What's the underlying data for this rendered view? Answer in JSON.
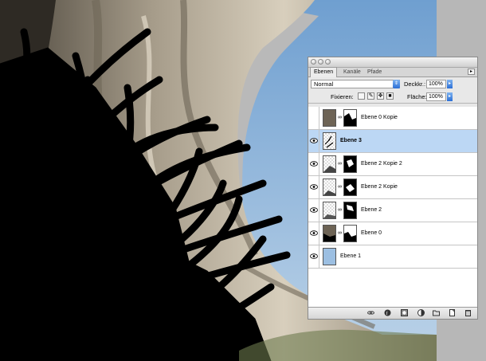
{
  "palette": {
    "tabs": [
      "Ebenen",
      "Kanäle",
      "Pfade"
    ],
    "blend_mode": "Normal",
    "opacity_label": "Deckkr.:",
    "opacity_value": "100%",
    "lock_label": "Fixieren:",
    "fill_label": "Fläche:",
    "fill_value": "100%",
    "layers": [
      {
        "name": "Ebene 0 Kopie",
        "visible": false,
        "selected": false
      },
      {
        "name": "Ebene 3",
        "visible": true,
        "selected": true
      },
      {
        "name": "Ebene 2 Kopie 2",
        "visible": true,
        "selected": false
      },
      {
        "name": "Ebene 2 Kopie",
        "visible": true,
        "selected": false
      },
      {
        "name": "Ebene 2",
        "visible": true,
        "selected": false
      },
      {
        "name": "Ebene 0",
        "visible": true,
        "selected": false
      },
      {
        "name": "Ebene 1",
        "visible": true,
        "selected": false
      }
    ]
  },
  "icons": [
    "eye-icon",
    "chain-link-icon",
    "lock-transparency-icon",
    "lock-paint-icon",
    "lock-move-icon",
    "lock-all-icon",
    "link-layers-icon",
    "layer-style-icon",
    "add-mask-icon",
    "adjustment-layer-icon",
    "new-group-icon",
    "new-layer-icon",
    "trash-icon"
  ],
  "colors": {
    "selection": "#bcd7f4",
    "sky": "#8fb3d8",
    "accent": "#2b6fd6"
  }
}
